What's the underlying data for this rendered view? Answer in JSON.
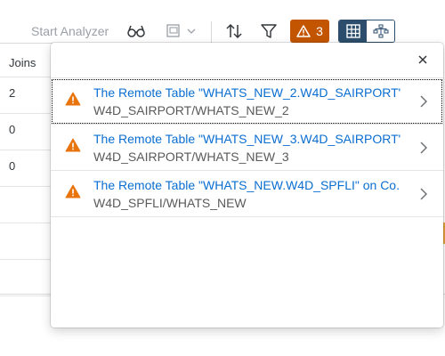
{
  "toolbar": {
    "start_analyzer_label": "Start Analyzer",
    "warning_count": "3"
  },
  "table": {
    "column_header": "Joins",
    "rows": [
      "2",
      "0",
      "0",
      "",
      "",
      ""
    ]
  },
  "popover": {
    "messages": [
      {
        "title": "The Remote Table \"WHATS_NEW_2.W4D_SAIRPORT\" on Co...",
        "subtitle": "W4D_SAIRPORT/WHATS_NEW_2"
      },
      {
        "title": "The Remote Table \"WHATS_NEW_3.W4D_SAIRPORT\" on Co...",
        "subtitle": "W4D_SAIRPORT/WHATS_NEW_3"
      },
      {
        "title": "The Remote Table \"WHATS_NEW.W4D_SPFLI\" on Co...",
        "subtitle": "W4D_SPFLI/WHATS_NEW"
      }
    ]
  },
  "colors": {
    "warning": "#e9730c",
    "link": "#0a6ed1",
    "warning_button": "#c35500",
    "toggle_active": "#2c4e6c"
  },
  "icons": [
    "glasses-icon",
    "image-dropdown-icon",
    "sort-icon",
    "filter-icon",
    "warning-icon",
    "table-view-icon",
    "graph-view-icon",
    "close-icon",
    "chevron-right-icon"
  ]
}
